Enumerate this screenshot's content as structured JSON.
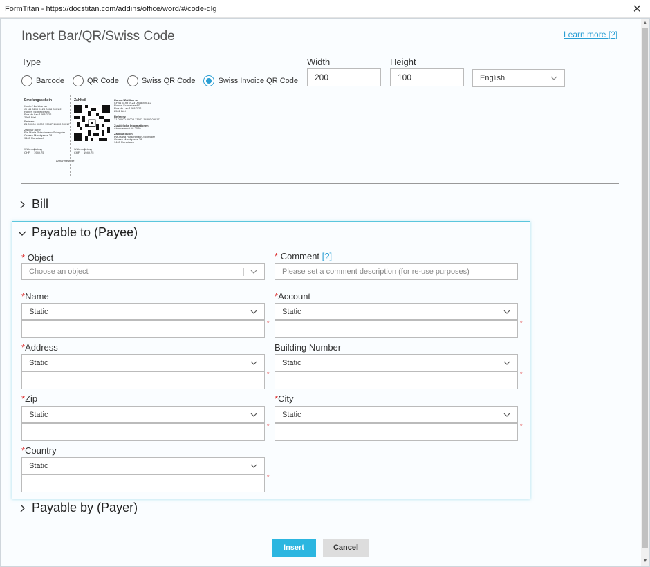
{
  "window": {
    "title": "FormTitan - https://docstitan.com/addins/office/word/#/code-dlg",
    "close": "✕"
  },
  "dialog": {
    "title": "Insert Bar/QR/Swiss Code",
    "learn_more": "Learn more [?]"
  },
  "type": {
    "label": "Type",
    "options": [
      {
        "label": "Barcode",
        "selected": false
      },
      {
        "label": "QR Code",
        "selected": false
      },
      {
        "label": "Swiss QR Code",
        "selected": false
      },
      {
        "label": "Swiss Invoice QR Code",
        "selected": true
      }
    ]
  },
  "size": {
    "width_label": "Width",
    "width_value": "200",
    "height_label": "Height",
    "height_value": "100",
    "language": "English"
  },
  "preview": {
    "receipt_title": "Empfangsschein",
    "payment_title": "Zahlteil",
    "account_lines": [
      "Konto / Zahlbar an",
      "CH44 3199 9123 0008 8901 2",
      "Robert Schneider AG",
      "Rue du Lac 1268/2/22",
      "2501 Biel"
    ],
    "reference_lines": [
      "Referenz",
      "21 00000 00003 13947 14300 09017"
    ],
    "info_lines": [
      "Zusätzliche Informationen",
      "Abonnement für 2020"
    ],
    "payer_lines": [
      "Zahlbar durch",
      "Pia-Maria Rutschmann-Schnyder",
      "Grosse Marktgasse 28",
      "9400 Rorschach"
    ],
    "receipt_lines": [
      "Konto / Zahlbar an",
      "CH44 3199 9123 0008 8901 2",
      "Robert Schneider AG",
      "Rue du Lac 1268/2/22",
      "2501 Biel",
      "Referenz",
      "21 00000 00003 13947 14300 09017",
      "Zahlbar durch",
      "Pia-Maria Rutschmann-Schnyder",
      "Grosse Marktgasse 28",
      "9400 Rorschach"
    ],
    "currency_label": "Währung",
    "amount_label": "Betrag",
    "currency": "CHF",
    "amount": "1949.75",
    "amount_payment": "1949.75",
    "accept": "Annahmestelle"
  },
  "sections": {
    "bill": "Bill",
    "payee": "Payable to (Payee)",
    "payer": "Payable by (Payer)"
  },
  "payee": {
    "object_label": "Object",
    "object_placeholder": "Choose an object",
    "comment_label": "Comment",
    "comment_help": "[?]",
    "comment_placeholder": "Please set a comment description (for re-use purposes)",
    "name_label": "Name",
    "account_label": "Account",
    "address_label": "Address",
    "building_label": "Building Number",
    "zip_label": "Zip",
    "city_label": "City",
    "country_label": "Country",
    "static": "Static",
    "asterisk": "*"
  },
  "buttons": {
    "insert": "Insert",
    "cancel": "Cancel"
  }
}
